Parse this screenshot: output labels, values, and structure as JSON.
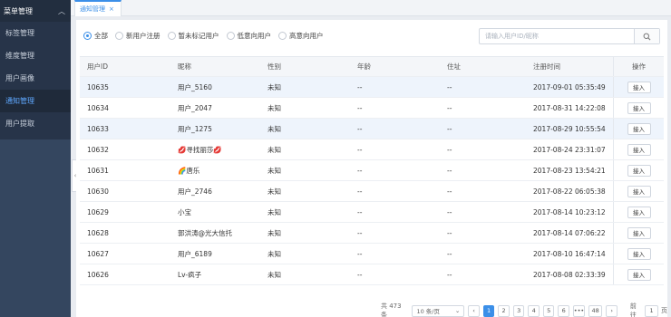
{
  "sidebar": {
    "title": "菜单管理",
    "items": [
      {
        "label": "标签管理"
      },
      {
        "label": "维度管理"
      },
      {
        "label": "用户画像"
      },
      {
        "label": "通知管理"
      },
      {
        "label": "用户提取"
      }
    ],
    "active_index": 3
  },
  "tabbar": {
    "tab_label": "通知管理",
    "tab_close": "×"
  },
  "filters": {
    "options": [
      "全部",
      "新用户注册",
      "暂未标记用户",
      "低意向用户",
      "高意向用户"
    ],
    "selected": "全部"
  },
  "search": {
    "placeholder": "请输入用户ID/昵称"
  },
  "table": {
    "columns": [
      "用户ID",
      "昵称",
      "性别",
      "年龄",
      "住址",
      "注册时间",
      "操作"
    ],
    "action_label": "接入",
    "rows": [
      {
        "id": "10635",
        "nick": "用户_5160",
        "gender": "未知",
        "age": "--",
        "addr": "--",
        "time": "2017-09-01 05:35:49"
      },
      {
        "id": "10634",
        "nick": "用户_2047",
        "gender": "未知",
        "age": "--",
        "addr": "--",
        "time": "2017-08-31 14:22:08"
      },
      {
        "id": "10633",
        "nick": "用户_1275",
        "gender": "未知",
        "age": "--",
        "addr": "--",
        "time": "2017-08-29 10:55:54"
      },
      {
        "id": "10632",
        "nick": "💋寻找丽莎💋",
        "gender": "未知",
        "age": "--",
        "addr": "--",
        "time": "2017-08-24 23:31:07"
      },
      {
        "id": "10631",
        "nick": "🌈唐乐",
        "gender": "未知",
        "age": "--",
        "addr": "--",
        "time": "2017-08-23 13:54:21"
      },
      {
        "id": "10630",
        "nick": "用户_2746",
        "gender": "未知",
        "age": "--",
        "addr": "--",
        "time": "2017-08-22 06:05:38"
      },
      {
        "id": "10629",
        "nick": "小宝",
        "gender": "未知",
        "age": "--",
        "addr": "--",
        "time": "2017-08-14 10:23:12"
      },
      {
        "id": "10628",
        "nick": "郭洪涛@光大信托",
        "gender": "未知",
        "age": "--",
        "addr": "--",
        "time": "2017-08-14 07:06:22"
      },
      {
        "id": "10627",
        "nick": "用户_6189",
        "gender": "未知",
        "age": "--",
        "addr": "--",
        "time": "2017-08-10 16:47:14"
      },
      {
        "id": "10626",
        "nick": "Lv-疯子",
        "gender": "未知",
        "age": "--",
        "addr": "--",
        "time": "2017-08-08 02:33:39"
      }
    ]
  },
  "pagination": {
    "total": "共 473 条",
    "page_size": "10 条/页",
    "pages": [
      "1",
      "2",
      "3",
      "4",
      "5",
      "6",
      "•••",
      "48"
    ],
    "current": "1",
    "goto_label": "前往",
    "goto_value": "1",
    "goto_suffix": "页"
  },
  "colors": {
    "accent": "#3b8fe8",
    "sidebar_bg": "#273449"
  }
}
